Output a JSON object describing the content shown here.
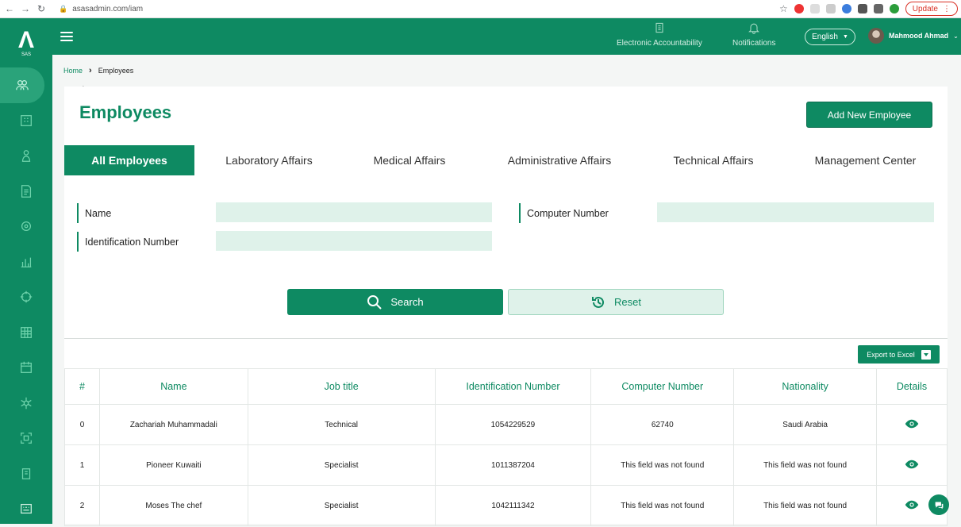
{
  "browser": {
    "url": "asasadmin.com/iam",
    "update_label": "Update"
  },
  "sidebar": {
    "logo_sub": "SAS",
    "items": [
      "users-icon",
      "building-icon",
      "person-icon",
      "document-icon",
      "settings-icon",
      "chart-icon",
      "target-icon",
      "grid-icon",
      "calendar-icon",
      "network-icon",
      "frame-icon",
      "book-icon",
      "keyboard-icon"
    ]
  },
  "header": {
    "accountability_label": "Electronic Accountability",
    "notifications_label": "Notifications",
    "language": "English",
    "user_name": "Mahmood Ahmad"
  },
  "breadcrumb": {
    "home": "Home",
    "current": "Employees"
  },
  "page": {
    "title": "Employees",
    "add_button": "Add New Employee"
  },
  "tabs": [
    {
      "label": "All Employees",
      "active": true
    },
    {
      "label": "Laboratory Affairs",
      "active": false
    },
    {
      "label": "Medical Affairs",
      "active": false
    },
    {
      "label": "Administrative Affairs",
      "active": false
    },
    {
      "label": "Technical Affairs",
      "active": false
    },
    {
      "label": "Management Center",
      "active": false
    }
  ],
  "filters": {
    "name_label": "Name",
    "name_value": "",
    "computer_number_label": "Computer Number",
    "computer_number_value": "",
    "identification_label": "Identification Number",
    "identification_value": ""
  },
  "actions": {
    "search_label": "Search",
    "reset_label": "Reset",
    "export_label": "Export to Excel"
  },
  "table": {
    "columns": [
      "#",
      "Name",
      "Job title",
      "Identification Number",
      "Computer Number",
      "Nationality",
      "Details"
    ],
    "rows": [
      [
        "0",
        "Zachariah Muhammadali",
        "Technical",
        "1054229529",
        "62740",
        "Saudi Arabia"
      ],
      [
        "1",
        "Pioneer Kuwaiti",
        "Specialist",
        "1011387204",
        "This field was not found",
        "This field was not found"
      ],
      [
        "2",
        "Moses The chef",
        "Specialist",
        "1042111342",
        "This field was not found",
        "This field was not found"
      ]
    ]
  },
  "colors": {
    "primary": "#0e8a62",
    "input_bg": "#dff2ea"
  }
}
